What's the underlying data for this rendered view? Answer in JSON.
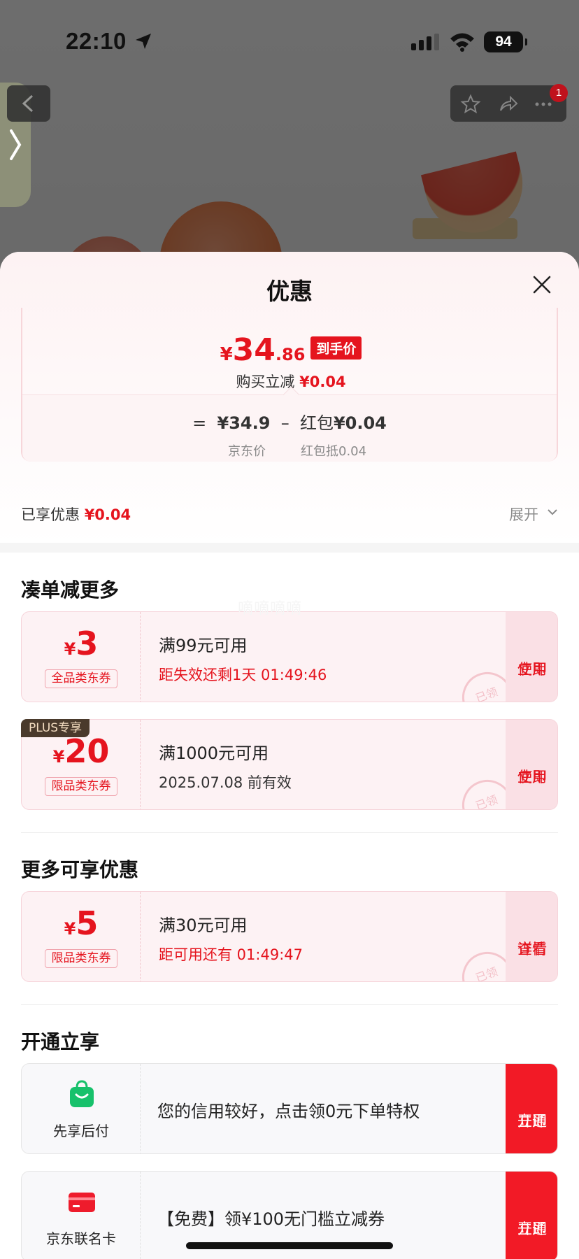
{
  "status_bar": {
    "time": "22:10",
    "battery": "94"
  },
  "background": {
    "notification_count": "1"
  },
  "sheet": {
    "title": "优惠",
    "price": {
      "yen": "¥",
      "integer": "34",
      "decimal": ".86",
      "tag": "到手价",
      "instant_label": "购买立减",
      "instant_value": "¥0.04",
      "formula_equals": "=",
      "formula_base": "¥34.9",
      "formula_minus": "–",
      "formula_item": "红包",
      "formula_item_value": "¥0.04",
      "base_caption": "京东价",
      "item_caption": "红包抵0.04"
    },
    "enjoyed_label": "已享优惠",
    "enjoyed_value": "¥0.04",
    "expand_label": "展开"
  },
  "section_more": {
    "title": "凑单减更多",
    "coupons": [
      {
        "yen": "¥",
        "amount": "3",
        "type": "全品类东券",
        "condition": "满99元可用",
        "note": "距失效还剩1天 01:49:46",
        "action_line1": "立即",
        "action_line2": "使用",
        "stamp": "已领"
      },
      {
        "plus_tag": "PLUS专享",
        "yen": "¥",
        "amount": "20",
        "type": "限品类东券",
        "condition": "满1000元可用",
        "note": "2025.07.08 前有效",
        "action_line1": "立即",
        "action_line2": "使用",
        "stamp": "已领"
      }
    ]
  },
  "section_extra": {
    "title": "更多可享优惠",
    "coupons": [
      {
        "yen": "¥",
        "amount": "5",
        "type": "限品类东券",
        "condition": "满30元可用",
        "note": "距可用还有 01:49:47",
        "action_line1": "查看",
        "action_line2": "详情",
        "stamp": "已领"
      }
    ]
  },
  "section_open": {
    "title": "开通立享",
    "items": [
      {
        "icon": "shopping-bag-icon",
        "label": "先享后付",
        "text": "您的信用较好，点击领0元下单特权",
        "action_line1": "立即",
        "action_line2": "开通"
      },
      {
        "icon": "credit-card-icon",
        "label": "京东联名卡",
        "text": "【免费】领¥100无门槛立减券",
        "action_line1": "立即",
        "action_line2": "开通"
      }
    ]
  },
  "watermark": "嘀嘀嘀嘀",
  "colors": {
    "accent_red": "#e5141e",
    "cta_red": "#f21a26",
    "coupon_bg": "#fdf2f4"
  }
}
